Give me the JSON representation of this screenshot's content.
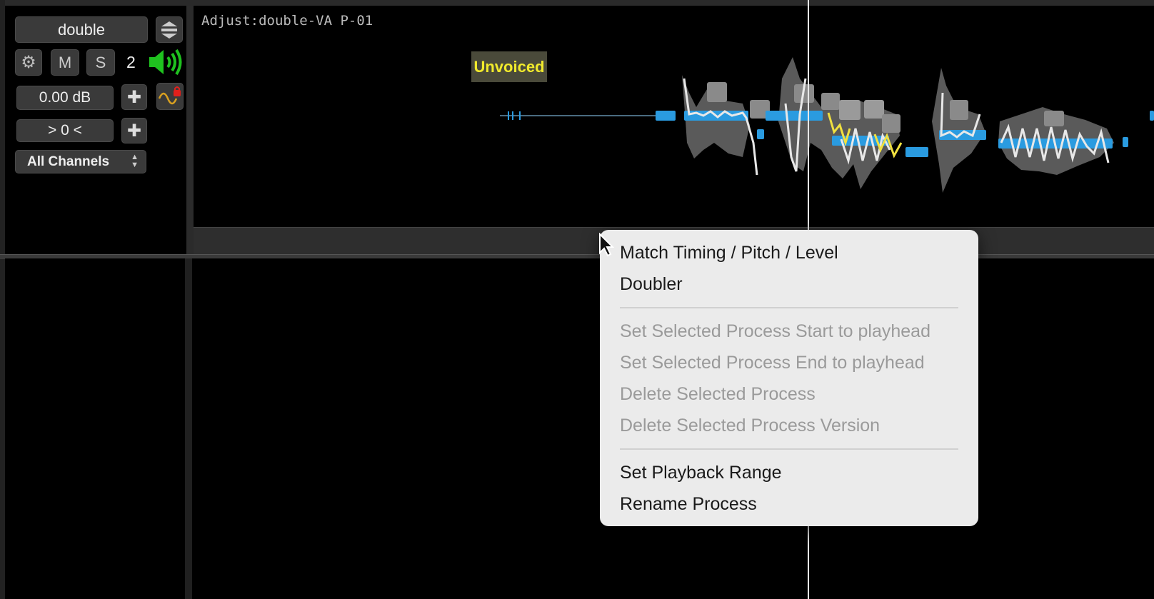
{
  "track": {
    "name": "double",
    "mute_label": "M",
    "solo_label": "S",
    "track_number": "2",
    "gain": "0.00 dB",
    "pan": "> 0 <",
    "channels": "All Channels"
  },
  "editor": {
    "process_title": "Adjust:double-VA P-01",
    "region_label": "Unvoiced"
  },
  "context_menu": {
    "items": [
      {
        "label": "Match Timing / Pitch / Level",
        "enabled": true
      },
      {
        "label": "Doubler",
        "enabled": true
      },
      {
        "label": "Set Selected Process Start to playhead",
        "enabled": false
      },
      {
        "label": "Set Selected Process End to playhead",
        "enabled": false
      },
      {
        "label": "Delete Selected Process",
        "enabled": false
      },
      {
        "label": "Delete Selected Process Version",
        "enabled": false
      },
      {
        "label": "Set Playback Range",
        "enabled": true
      },
      {
        "label": "Rename Process",
        "enabled": true
      }
    ]
  },
  "colors": {
    "background": "#000000",
    "pitch_blue": "#2a9be0",
    "pitch_trace_yellow": "#f0e040",
    "speaker_green": "#1fc21f",
    "label_yellow": "#f1ea2c",
    "menu_bg": "#ebebeb"
  },
  "icons": [
    "lane-toggle-icon",
    "gear-icon",
    "speaker-icon",
    "plus-icon",
    "waveform-lock-icon",
    "updown-arrows-icon",
    "mouse-pointer-icon"
  ]
}
